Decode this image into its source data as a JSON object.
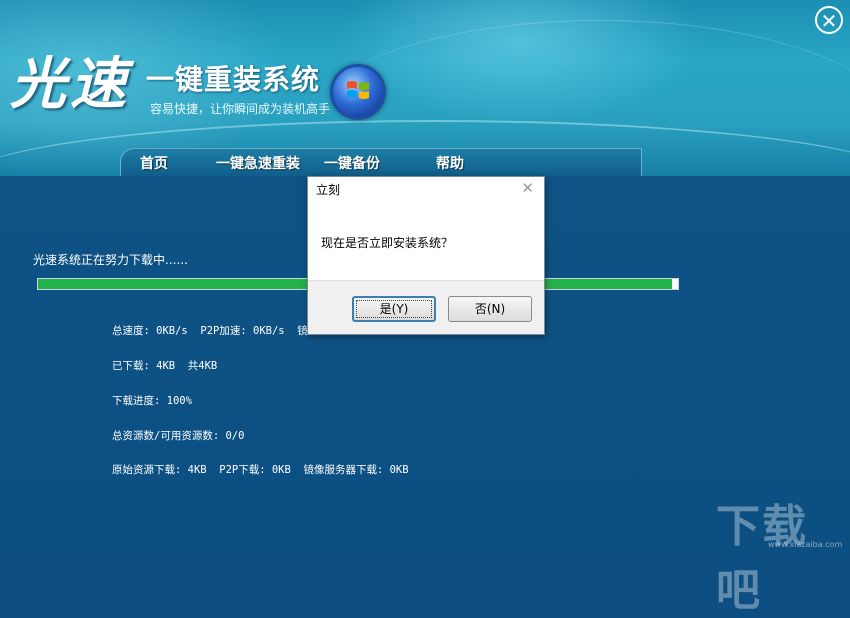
{
  "header": {
    "brand_big": "光速",
    "brand_title": "一键重装系统",
    "brand_sub": "容易快捷，让你瞬间成为装机高手",
    "logo_icon": "windows-orb-icon",
    "close_icon": "close-icon"
  },
  "nav": {
    "items": [
      {
        "label": "首页"
      },
      {
        "label": "一键急速重装"
      },
      {
        "label": "一键备份"
      },
      {
        "label": "帮助"
      }
    ]
  },
  "main": {
    "status": "光速系统正在努力下载中......",
    "progress": 0.99,
    "stats": {
      "line1": "总速度: 0KB/s  P2P加速: 0KB/s  镜",
      "line2": "已下载: 4KB  共4KB",
      "line3": "下载进度: 100%",
      "line4": "总资源数/可用资源数: 0/0",
      "line5": "原始资源下载: 4KB  P2P下载: 0KB  镜像服务器下载: 0KB"
    }
  },
  "dialog": {
    "title": "立刻",
    "message": "现在是否立即安装系统？",
    "yes_label": "是(Y)",
    "no_label": "否(N)"
  },
  "watermark": {
    "text": "下载吧",
    "sub": "www.xiazaiba.com"
  },
  "colors": {
    "accent": "#25b14a",
    "main_bg": "#0d4f83",
    "header_bg": "#29a6c6"
  }
}
